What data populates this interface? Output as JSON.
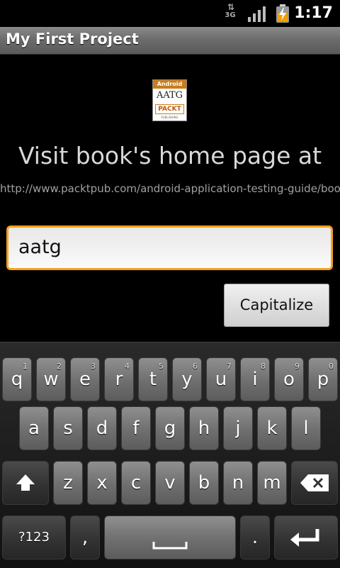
{
  "status_bar": {
    "network": "3G",
    "time": "1:17"
  },
  "app": {
    "title": "My First Project"
  },
  "logo": {
    "band": "Android",
    "line1": "AATG",
    "line2": "PACKT",
    "line3": "PUBLISHING"
  },
  "content": {
    "visit_text": "Visit book's home page at",
    "url": "http://www.packtpub.com/android-application-testing-guide/book",
    "input_value": "aatg",
    "capitalize_label": "Capitalize"
  },
  "keyboard": {
    "row1": [
      {
        "label": "q",
        "sub": "1"
      },
      {
        "label": "w",
        "sub": "2"
      },
      {
        "label": "e",
        "sub": "3"
      },
      {
        "label": "r",
        "sub": "4"
      },
      {
        "label": "t",
        "sub": "5"
      },
      {
        "label": "y",
        "sub": "6"
      },
      {
        "label": "u",
        "sub": "7"
      },
      {
        "label": "i",
        "sub": "8"
      },
      {
        "label": "o",
        "sub": "9"
      },
      {
        "label": "p",
        "sub": "0"
      }
    ],
    "row2": [
      "a",
      "s",
      "d",
      "f",
      "g",
      "h",
      "j",
      "k",
      "l"
    ],
    "row3": [
      "z",
      "x",
      "c",
      "v",
      "b",
      "n",
      "m"
    ],
    "symbols_label": "?123",
    "comma_label": ",",
    "period_label": "."
  },
  "colors": {
    "accent": "#f7a11c",
    "titlebar": "#6a6a6a"
  }
}
